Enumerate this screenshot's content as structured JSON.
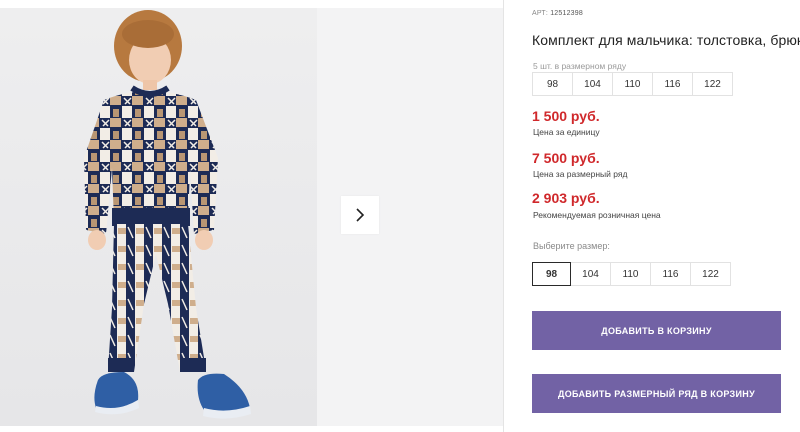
{
  "product": {
    "article_label": "АРТ:",
    "article_number": "12512398",
    "title": "Комплект для мальчика: толстовка, брюки",
    "size_row_note": "5 шт. в размерном ряду",
    "size_row": [
      "98",
      "104",
      "110",
      "116",
      "122"
    ]
  },
  "prices": [
    {
      "value": "1 500 руб.",
      "label": "Цена за единицу"
    },
    {
      "value": "7 500 руб.",
      "label": "Цена за размерный ряд"
    },
    {
      "value": "2 903 руб.",
      "label": "Рекомендуемая розничная цена"
    }
  ],
  "size_picker": {
    "label": "Выберите размер:",
    "options": [
      "98",
      "104",
      "110",
      "116",
      "122"
    ],
    "selected": "98"
  },
  "buttons": {
    "add_to_cart": "ДОБАВИТЬ В КОРЗИНУ",
    "add_size_row_to_cart": "ДОБАВИТЬ РАЗМЕРНЫЙ РЯД В КОРЗИНУ"
  },
  "colors": {
    "price_red": "#d0282b",
    "button_purple": "#7262a5"
  },
  "icons": {
    "next": "chevron-right-icon"
  }
}
